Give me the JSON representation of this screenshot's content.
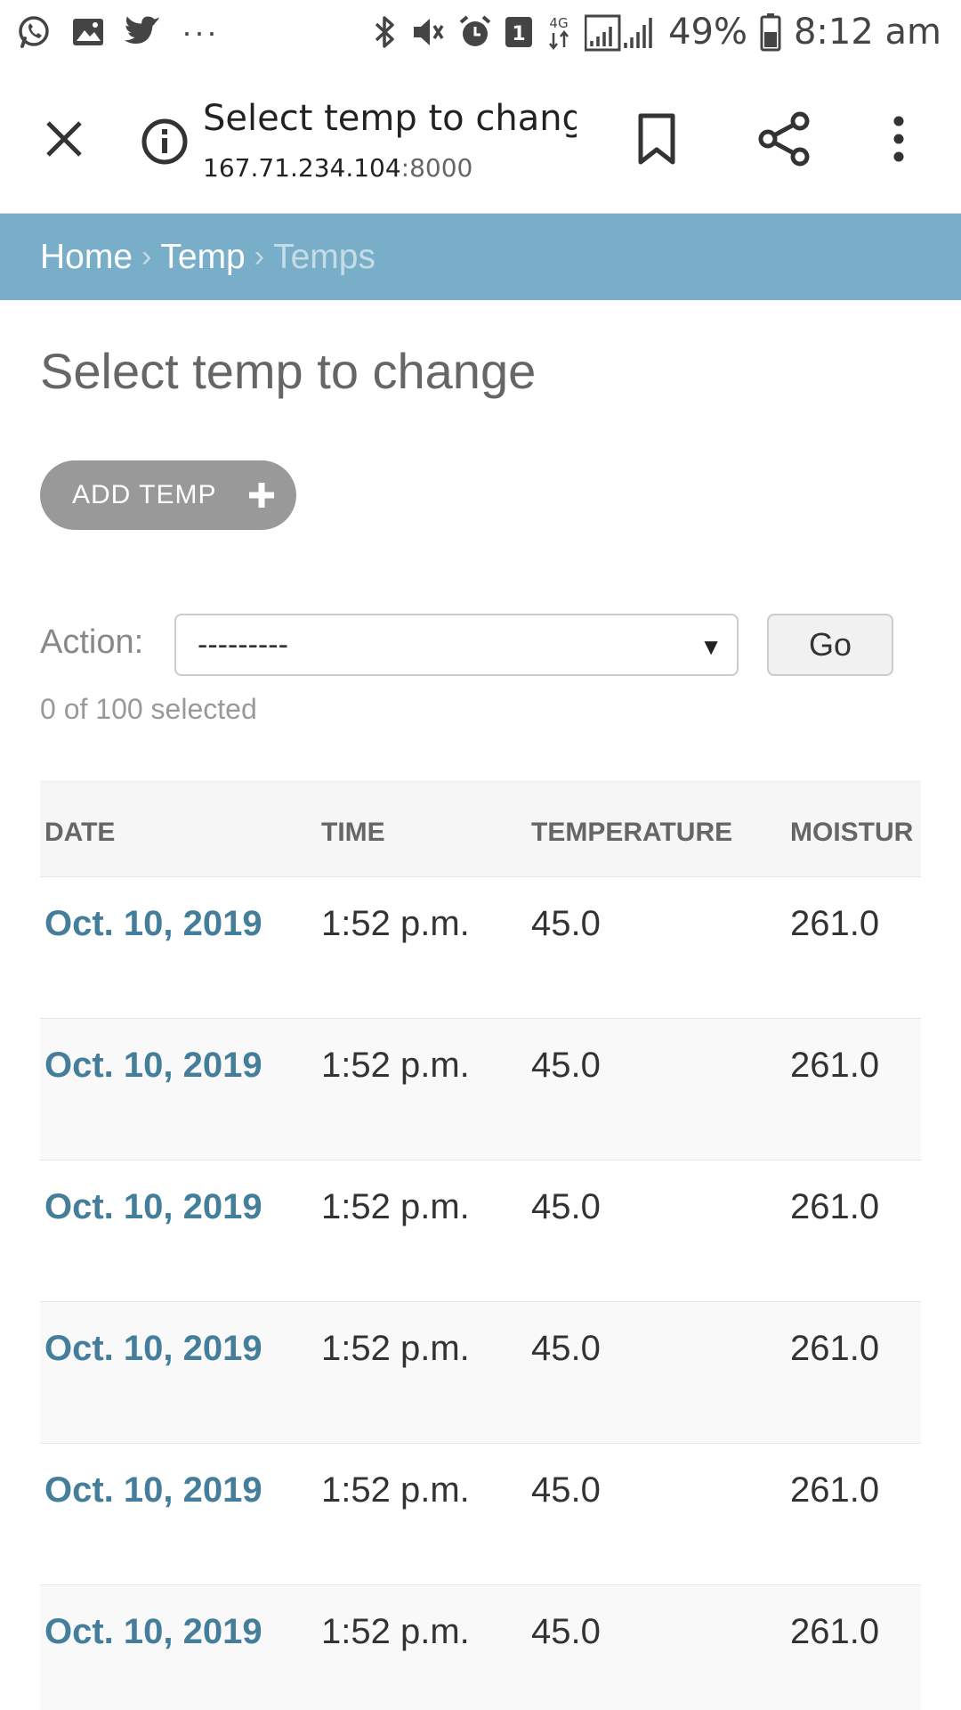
{
  "status_bar": {
    "left_icons": [
      "whatsapp-icon",
      "gallery-icon",
      "twitter-icon"
    ],
    "overflow": "···",
    "battery": "49%",
    "time": "8:12 am",
    "network": "4G",
    "notification_count": "1"
  },
  "browser": {
    "title": "Select temp to chang...",
    "url_host": "167.71.234.104",
    "url_port": ":8000"
  },
  "breadcrumbs": {
    "home": "Home",
    "app": "Temp",
    "current": "Temps",
    "separator": "›"
  },
  "page": {
    "title": "Select temp to change",
    "add_button_label": "ADD TEMP"
  },
  "actions": {
    "label": "Action:",
    "selected_option": "---------",
    "go_label": "Go",
    "selected_count": "0 of 100 selected"
  },
  "table": {
    "headers": [
      "DATE",
      "TIME",
      "TEMPERATURE",
      "MOISTUR"
    ],
    "rows": [
      [
        "Oct. 10, 2019",
        "1:52 p.m.",
        "45.0",
        "261.0"
      ],
      [
        "Oct. 10, 2019",
        "1:52 p.m.",
        "45.0",
        "261.0"
      ],
      [
        "Oct. 10, 2019",
        "1:52 p.m.",
        "45.0",
        "261.0"
      ],
      [
        "Oct. 10, 2019",
        "1:52 p.m.",
        "45.0",
        "261.0"
      ],
      [
        "Oct. 10, 2019",
        "1:52 p.m.",
        "45.0",
        "261.0"
      ],
      [
        "Oct. 10, 2019",
        "1:52 p.m.",
        "45.0",
        "261.0"
      ]
    ]
  },
  "colors": {
    "breadcrumb_bg": "#79aec8",
    "link": "#447e9b",
    "add_button_bg": "#999999"
  }
}
